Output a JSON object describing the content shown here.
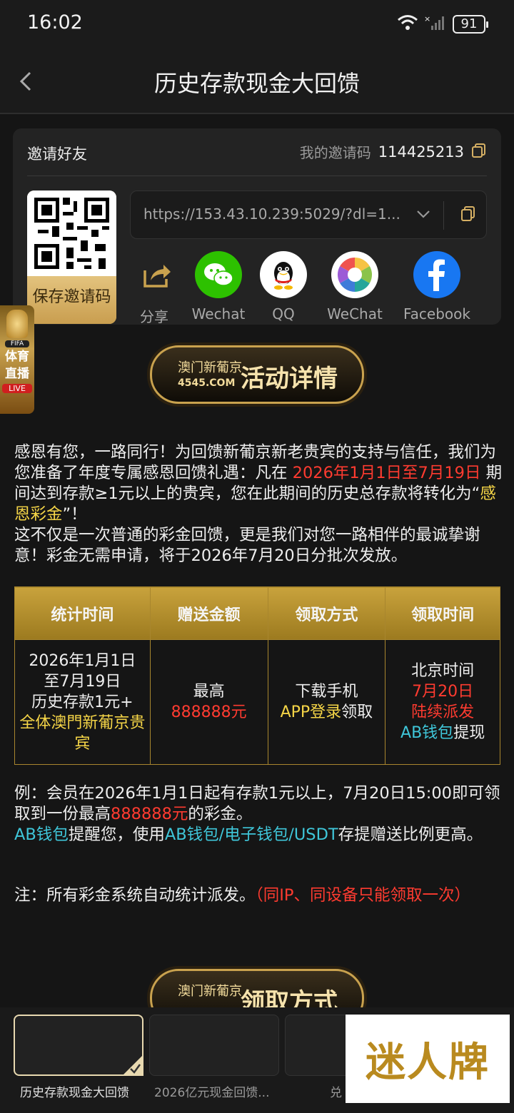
{
  "status_bar": {
    "time": "16:02",
    "battery": "91"
  },
  "header": {
    "title": "历史存款现金大回馈"
  },
  "invite": {
    "title": "邀请好友",
    "code_label": "我的邀请码",
    "code": "114425213",
    "link": "https://153.43.10.239:5029/?dl=1...",
    "save_label": "保存邀请码",
    "share_items": [
      {
        "label": "分享",
        "icon": "share-icon"
      },
      {
        "label": "Wechat",
        "icon": "wechat-icon"
      },
      {
        "label": "QQ",
        "icon": "qq-icon"
      },
      {
        "label": "WeChat",
        "icon": "moments-icon"
      },
      {
        "label": "Facebook",
        "icon": "facebook-icon"
      }
    ]
  },
  "float_badge": {
    "cup_label": "FIFA",
    "text1": "体育",
    "text2": "直播",
    "live": "LIVE"
  },
  "banner_detail": {
    "brand": "澳门新葡京",
    "domain": "4545.COM",
    "title": "活动详情"
  },
  "banner_claim": {
    "brand": "澳门新葡京",
    "title": "领取方式"
  },
  "intro": {
    "p1_a": "感恩有您，一路同行！为回馈新葡京新老贵宾的支持与信任，我们为您准备了年度专属感恩回馈礼遇：凡在 ",
    "p1_date": "2026年1月1日至7月19日",
    "p1_b": " 期间达到存款≥1元以上的贵宾，您在此期间的历史总存款将转化为“",
    "p1_highlight": "感恩彩金",
    "p1_c": "”！",
    "p2": "这不仅是一次普通的彩金回馈，更是我们对您一路相伴的最诚挚谢意！彩金无需申请，将于2026年7月20日分批次发放。"
  },
  "table": {
    "headers": [
      "统计时间",
      "赠送金额",
      "领取方式",
      "领取时间"
    ],
    "period_line1": "2026年1月1日",
    "period_line2": "至7月19日",
    "period_line3": "历史存款1元+",
    "period_target": "全体澳門新葡京贵宾",
    "amount_prefix": "最高",
    "amount_value": "888888元",
    "method_line1": "下载手机",
    "method_app": "APP登录",
    "method_suffix": "领取",
    "time_line1": "北京时间",
    "time_line2": "7月20日",
    "time_line3": "陆续派发",
    "time_wallet": "AB钱包",
    "time_suffix": "提现"
  },
  "example": {
    "a": "例：会员在2026年1月1日起有存款1元以上，7月20日15:00即可领取到一份最高",
    "amount": "888888元",
    "b": "的彩金。",
    "wallet": "AB钱包",
    "c": "提醒您，使用",
    "wallets": "AB钱包/电子钱包/USDT",
    "d": "存提赠送比例更高。"
  },
  "note": {
    "a": "注：所有彩金系统自动统计派发。",
    "red": "（同IP、同设备只能领取一次）"
  },
  "bottom_tabs": [
    "历史存款现金大回馈",
    "2026亿元现金回馈...",
    "兑"
  ],
  "watermark": "迷人牌",
  "colors": {
    "accent_gold": "#c9a24e",
    "highlight_red": "#ff3b30",
    "highlight_yellow": "#f5d547",
    "highlight_cyan": "#3fc6d9"
  }
}
